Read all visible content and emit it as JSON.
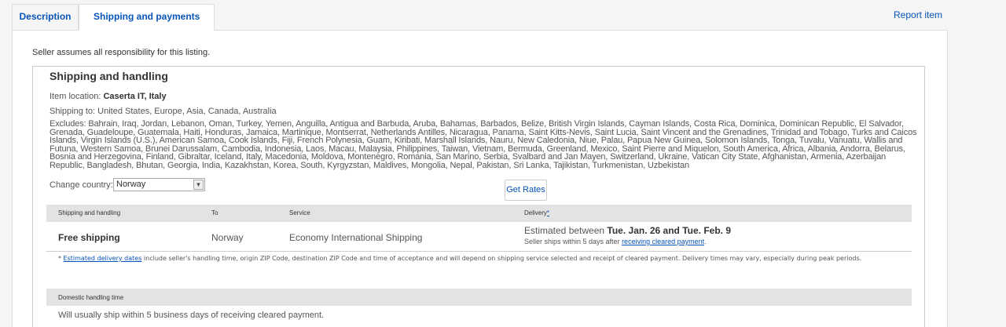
{
  "tabs": {
    "description": "Description",
    "shipping": "Shipping and payments"
  },
  "report": "Report item",
  "responsibility": "Seller assumes all responsibility for this listing.",
  "section": {
    "title": "Shipping and handling",
    "location_label": "Item location: ",
    "location": "Caserta IT, Italy",
    "shipping_to": "Shipping to: United States, Europe, Asia, Canada, Australia",
    "excludes": "Excludes: Bahrain, Iraq, Jordan, Lebanon, Oman, Turkey, Yemen, Anguilla, Antigua and Barbuda, Aruba, Bahamas, Barbados, Belize, British Virgin Islands, Cayman Islands, Costa Rica, Dominica, Dominican Republic, El Salvador, Grenada, Guadeloupe, Guatemala, Haiti, Honduras, Jamaica, Martinique, Montserrat, Netherlands Antilles, Nicaragua, Panama, Saint Kitts-Nevis, Saint Lucia, Saint Vincent and the Grenadines, Trinidad and Tobago, Turks and Caicos Islands, Virgin Islands (U.S.), American Samoa, Cook Islands, Fiji, French Polynesia, Guam, Kiribati, Marshall Islands, Nauru, New Caledonia, Niue, Palau, Papua New Guinea, Solomon Islands, Tonga, Tuvalu, Vanuatu, Wallis and Futuna, Western Samoa, Brunei Darussalam, Cambodia, Indonesia, Laos, Macau, Malaysia, Philippines, Taiwan, Vietnam, Bermuda, Greenland, Mexico, Saint Pierre and Miquelon, South America, Africa, Albania, Andorra, Belarus, Bosnia and Herzegovina, Finland, Gibraltar, Iceland, Italy, Macedonia, Moldova, Montenegro, Romania, San Marino, Serbia, Svalbard and Jan Mayen, Switzerland, Ukraine, Vatican City State, Afghanistan, Armenia, Azerbaijan Republic, Bangladesh, Bhutan, Georgia, India, Kazakhstan, Korea, South, Kyrgyzstan, Maldives, Mongolia, Nepal, Pakistan, Sri Lanka, Tajikistan, Turkmenistan, Uzbekistan",
    "change_country": "Change country:",
    "country_value": "Norway",
    "get_rates": "Get Rates"
  },
  "table": {
    "headers": [
      "Shipping and handling",
      "To",
      "Service",
      "Delivery"
    ],
    "delivery_star": "*",
    "row": {
      "cost": "Free shipping",
      "to": "Norway",
      "service": "Economy International Shipping",
      "est_prefix": "Estimated between ",
      "est_dates": "Tue. Jan. 26 and Tue. Feb. 9",
      "ships_prefix": "Seller ships within 5 days after ",
      "ships_link": "receiving cleared payment",
      "ships_suffix": "."
    },
    "note_prefix": "* ",
    "note_link": "Estimated delivery dates",
    "note_text": " include seller's handling time, origin ZIP Code, destination ZIP Code and time of acceptance and will depend on shipping service selected and receipt of cleared payment. Delivery times may vary, especially during peak periods."
  },
  "domestic": {
    "header": "Domestic handling time",
    "text": "Will usually ship within 5 business days of receiving cleared payment."
  }
}
